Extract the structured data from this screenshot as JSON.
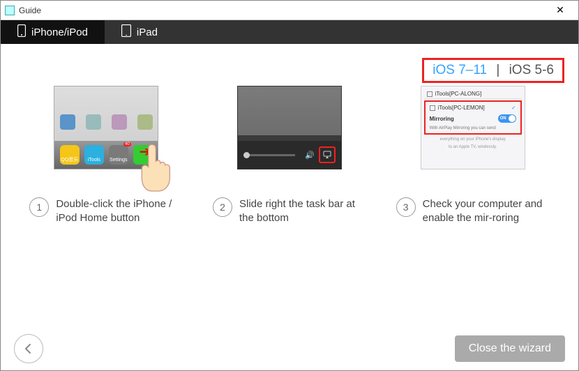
{
  "titlebar": {
    "title": "Guide"
  },
  "tabs": {
    "iphone": "iPhone/iPod",
    "ipad": "iPad"
  },
  "versions": {
    "active": "iOS 7–11",
    "inactive": "iOS 5-6",
    "sep": "|"
  },
  "steps": [
    {
      "num": "1",
      "text": "Double-click the iPhone / iPod Home button"
    },
    {
      "num": "2",
      "text": "Slide right the task bar at the bottom"
    },
    {
      "num": "3",
      "text": "Check your computer and enable the mir-roring"
    }
  ],
  "step1_dock": {
    "app1": "QQ音乐",
    "app2": "iTools",
    "app3": "Settings",
    "app4": ""
  },
  "step1_badge": "40",
  "step3_panel": {
    "dev1": "iTools[PC-ALONG]",
    "dev2": "iTools[PC-LEMON]",
    "mirroring": "Mirroring",
    "on": "ON",
    "note": "With AirPlay Mirroring you can send",
    "foot1": "everything on your iPhone's display",
    "foot2": "to an Apple TV, wirelessly."
  },
  "footer": {
    "close": "Close the wizard"
  }
}
